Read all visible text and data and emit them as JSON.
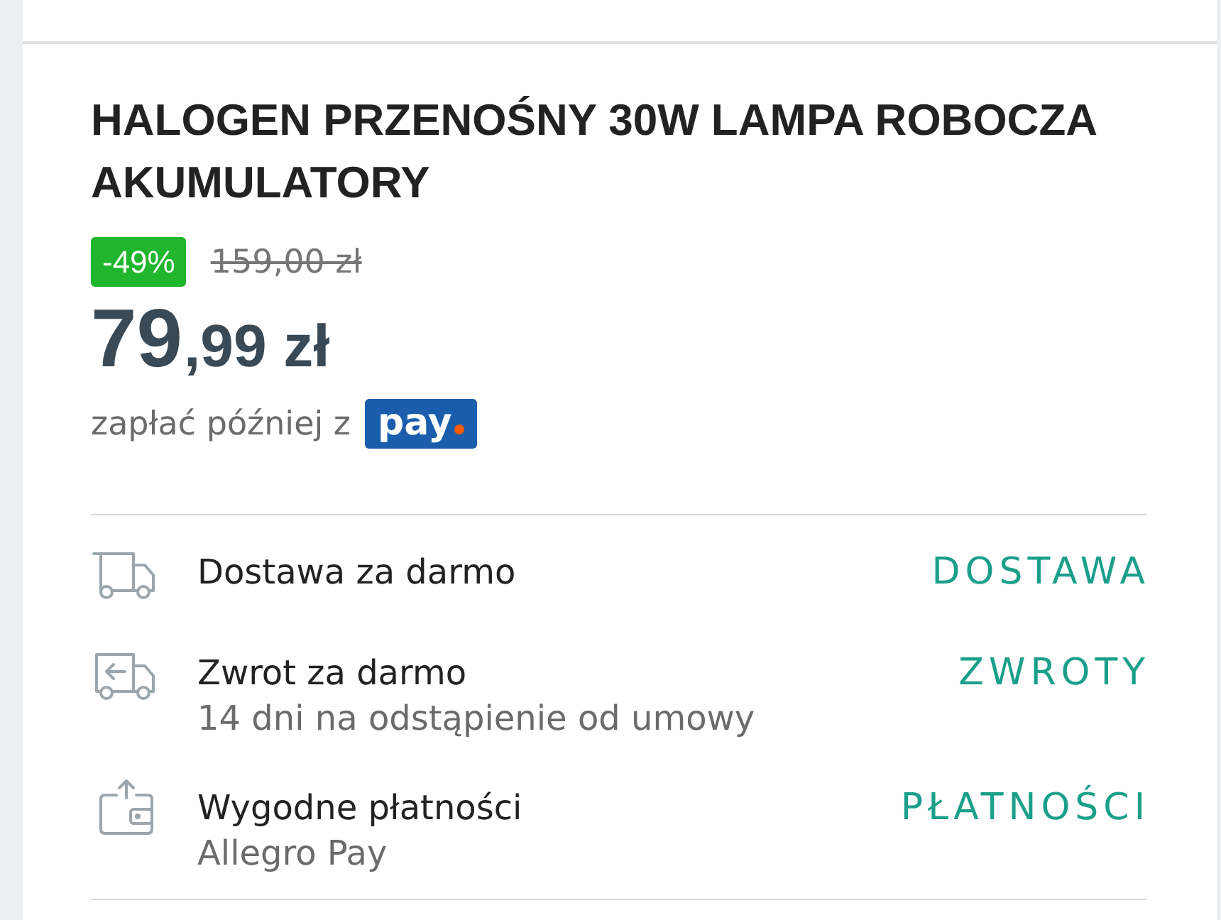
{
  "title": "HALOGEN PRZENOŚNY 30W LAMPA ROBOCZA AKUMULATORY",
  "pricing": {
    "discount": "-49%",
    "old_price": "159,00 zł",
    "price_whole": "79",
    "price_rest": ",99 zł"
  },
  "pay_later": {
    "text": "zapłać później z",
    "logo": "pay"
  },
  "benefits": [
    {
      "kind": "delivery",
      "title": "Dostawa za darmo",
      "link": "DOSTAWA"
    },
    {
      "kind": "returns",
      "title": "Zwrot za darmo",
      "subtitle": "14 dni na odstąpienie od umowy",
      "link": "ZWROTY"
    },
    {
      "kind": "payment",
      "title": "Wygodne płatności",
      "subtitle": "Allegro Pay",
      "link": "PŁATNOŚCI"
    }
  ]
}
